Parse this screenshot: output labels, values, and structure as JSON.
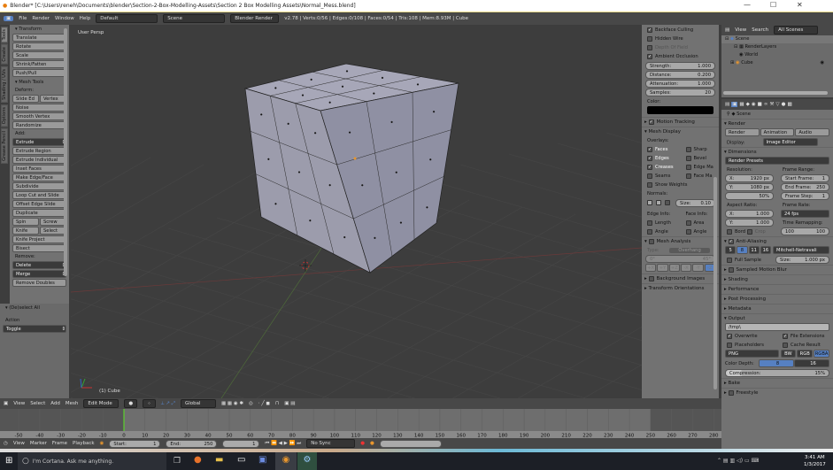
{
  "window": {
    "title": "Blender* [C:\\Users\\reneh\\Documents\\blender\\Section-2-Box-Modelling-Assets\\Section 2 Box Modelling Assets\\Normal_Mess.blend]",
    "minimize": "—",
    "maximize": "☐",
    "close": "✕"
  },
  "info_header": {
    "menus": [
      "File",
      "Render",
      "Window",
      "Help"
    ],
    "layout": "Default",
    "scene": "Scene",
    "engine": "Blender Render",
    "stats": "v2.78 | Verts:0/56 | Edges:0/108 | Faces:0/54 | Tris:108 | Mem:8.93M | Cube"
  },
  "tool_tabs": [
    "Tools",
    "Create",
    "Shading / UVs",
    "Options",
    "Grease Pencil"
  ],
  "toolshelf": {
    "transform_title": "Transform",
    "transform": [
      "Translate",
      "Rotate",
      "Scale",
      "Shrink/Fatten",
      "Push/Pull"
    ],
    "mesh_tools_title": "Mesh Tools",
    "deform_label": "Deform:",
    "deform_row": [
      "Slide Ed",
      "Vertex"
    ],
    "deform": [
      "Noise",
      "Smooth Vertex",
      "Randomize"
    ],
    "add_label": "Add:",
    "add_select": "Extrude",
    "add": [
      "Extrude Region",
      "Extrude Individual",
      "Inset Faces",
      "Make Edge/Face",
      "Subdivide",
      "Loop Cut and Slide",
      "Offset Edge Slide",
      "Duplicate"
    ],
    "add_row1": [
      "Spin",
      "Screw"
    ],
    "add_row2": [
      "Knife",
      "Select"
    ],
    "add2": [
      "Knife Project",
      "Bisect"
    ],
    "remove_label": "Remove:",
    "remove_selects": [
      "Delete",
      "Merge"
    ],
    "remove_doubles": "Remove Doubles"
  },
  "operator": {
    "title": "(De)select All",
    "action_label": "Action",
    "action": "Toggle"
  },
  "viewport": {
    "label": "User Persp",
    "object": "(1) Cube"
  },
  "npanel": {
    "checks": [
      {
        "label": "Backface Culling",
        "on": true
      },
      {
        "label": "Hidden Wire",
        "on": false
      },
      {
        "label": "Depth Of Field",
        "on": false
      },
      {
        "label": "Ambient Occlusion",
        "on": true
      }
    ],
    "fields": [
      {
        "label": "Strength:",
        "value": "1.000"
      },
      {
        "label": "Distance:",
        "value": "0.200"
      },
      {
        "label": "Attenuation:",
        "value": "1.000"
      },
      {
        "label": "Samples:",
        "value": "20"
      }
    ],
    "color_label": "Color:",
    "motion_tracking": "Motion Tracking",
    "mesh_display": "Mesh Display",
    "overlays_label": "Overlays:",
    "overlays": [
      {
        "label": "Faces",
        "on": true
      },
      {
        "label": "Sharp",
        "on": false
      },
      {
        "label": "Edges",
        "on": true
      },
      {
        "label": "Bevel",
        "on": false
      },
      {
        "label": "Creases",
        "on": true
      },
      {
        "label": "Edge Ma",
        "on": false
      },
      {
        "label": "Seams",
        "on": false
      },
      {
        "label": "Face Ma",
        "on": false
      }
    ],
    "show_weights": "Show Weights",
    "normals_label": "Normals:",
    "size_label": "Size:",
    "size_value": "0.10",
    "edge_info": "Edge Info:",
    "face_info": "Face Info:",
    "edge_items": [
      "Length",
      "Angle"
    ],
    "face_items": [
      "Area",
      "Angle"
    ],
    "mesh_analysis": "Mesh Analysis",
    "type_label": "Type:",
    "type_value": "Overhang",
    "angle_min": "0°",
    "angle_max": "45°",
    "axes": [
      "+X",
      "+Y",
      "+Z",
      "-X",
      "-Y",
      "-Z"
    ],
    "background_images": "Background Images",
    "transform_orientations": "Transform Orientations"
  },
  "outliner": {
    "menus": [
      "View",
      "Search"
    ],
    "filter": "All Scenes",
    "items": [
      "Scene",
      "RenderLayers",
      "World",
      "Cube"
    ]
  },
  "properties": {
    "context": "Scene",
    "render_title": "Render",
    "render_buttons": [
      "Render",
      "Animation",
      "Audio"
    ],
    "display_label": "Display:",
    "display_value": "Image Editor",
    "dimensions_title": "Dimensions",
    "presets": "Render Presets",
    "resolution_label": "Resolution:",
    "res_x": "1920 px",
    "res_y": "1080 px",
    "res_pct": "50%",
    "frame_range_label": "Frame Range:",
    "start_frame": "1",
    "end_frame": "250",
    "frame_step": "1",
    "aspect_label": "Aspect Ratio:",
    "aspect_x": "1.000",
    "aspect_y": "1.000",
    "frame_rate_label": "Frame Rate:",
    "frame_rate": "24 fps",
    "time_remap_label": "Time Remapping:",
    "remap_old": "100",
    "remap_new": "100",
    "bord": "Bord",
    "crop": "Crop",
    "aa_title": "Anti-Aliasing",
    "aa_samples": [
      "5",
      "8",
      "11",
      "16"
    ],
    "aa_active": "8",
    "aa_filter": "Mitchell-Netravali",
    "full_sample": "Full Sample",
    "filter_size": "1.000 px",
    "collapsed": [
      "Sampled Motion Blur",
      "Shading",
      "Performance",
      "Post Processing",
      "Metadata"
    ],
    "output_title": "Output",
    "output_path": "/tmp\\",
    "overwrite": "Overwrite",
    "file_ext": "File Extensions",
    "placeholders": "Placeholders",
    "cache_result": "Cache Result",
    "format": "PNG",
    "color_modes": [
      "BW",
      "RGB",
      "RGBA"
    ],
    "color_mode_active": "RGBA",
    "color_depth_label": "Color Depth:",
    "depths": [
      "8",
      "16"
    ],
    "compression_label": "Compression:",
    "compression": "15%",
    "compression_value": 15,
    "bake": "Bake",
    "freestyle": "Freestyle"
  },
  "view3d_header": {
    "menus": [
      "View",
      "Select",
      "Add",
      "Mesh"
    ],
    "mode": "Edit Mode",
    "orientation": "Global"
  },
  "timeline": {
    "ticks": [
      -50,
      -40,
      -30,
      -20,
      -10,
      0,
      10,
      20,
      30,
      40,
      50,
      60,
      70,
      80,
      90,
      100,
      110,
      120,
      130,
      140,
      150,
      160,
      170,
      180,
      190,
      200,
      210,
      220,
      230,
      240,
      250,
      260,
      270,
      280
    ],
    "current": 1,
    "menus": [
      "View",
      "Marker",
      "Frame",
      "Playback"
    ],
    "start_label": "Start:",
    "start": "1",
    "end_label": "End:",
    "end": "250",
    "frame": "1",
    "sync": "No Sync"
  },
  "taskbar": {
    "search": "I'm Cortana. Ask me anything.",
    "time": "3:41 AM",
    "date": "1/3/2017"
  },
  "colors": {
    "accent": "#5680c2",
    "timeline_marker": "#5ad02c",
    "viewport": "#3d3d3d",
    "panel": "#727272"
  }
}
